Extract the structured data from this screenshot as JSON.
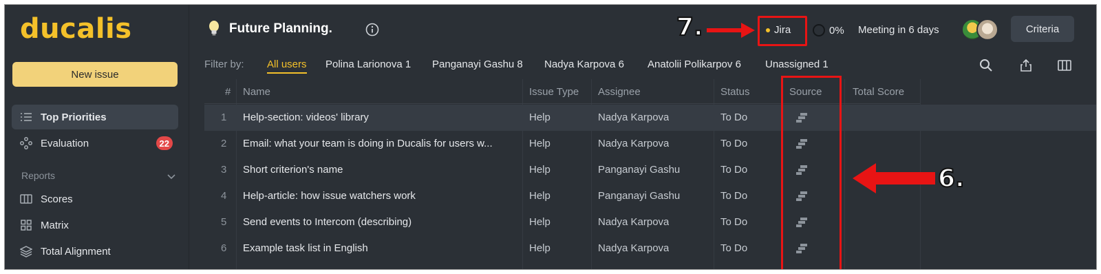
{
  "app": {
    "logo": "ducalis",
    "new_issue_label": "New issue"
  },
  "sidebar": {
    "items": [
      {
        "label": "Top Priorities",
        "icon": "list-icon",
        "active": true
      },
      {
        "label": "Evaluation",
        "icon": "nodes-icon",
        "badge": "22"
      }
    ],
    "reports_label": "Reports",
    "reports": [
      {
        "label": "Scores",
        "icon": "columns-icon"
      },
      {
        "label": "Matrix",
        "icon": "grid-icon"
      },
      {
        "label": "Total Alignment",
        "icon": "layers-icon"
      }
    ]
  },
  "header": {
    "title": "Future Planning.",
    "integration": "Jira",
    "progress": "0%",
    "meeting": "Meeting in 6 days",
    "criteria_label": "Criteria"
  },
  "annotations": {
    "seven": "7.",
    "six": "6."
  },
  "filter": {
    "label": "Filter by:",
    "items": [
      "All users",
      "Polina Larionova 1",
      "Panganayi Gashu 8",
      "Nadya Karpova 6",
      "Anatolii Polikarpov 6",
      "Unassigned 1"
    ]
  },
  "table": {
    "headers": [
      "#",
      "Name",
      "Issue Type",
      "Assignee",
      "Status",
      "Source",
      "Total Score"
    ],
    "rows": [
      {
        "num": "1",
        "name": "Help-section: videos' library",
        "type": "Help",
        "assignee": "Nadya Karpova",
        "status": "To Do"
      },
      {
        "num": "2",
        "name": "Email: what your team is doing in Ducalis for users w...",
        "type": "Help",
        "assignee": "Nadya Karpova",
        "status": "To Do"
      },
      {
        "num": "3",
        "name": "Short criterion's name",
        "type": "Help",
        "assignee": "Panganayi Gashu",
        "status": "To Do"
      },
      {
        "num": "4",
        "name": "Help-article: how issue watchers work",
        "type": "Help",
        "assignee": "Panganayi Gashu",
        "status": "To Do"
      },
      {
        "num": "5",
        "name": "Send events to Intercom (describing)",
        "type": "Help",
        "assignee": "Nadya Karpova",
        "status": "To Do"
      },
      {
        "num": "6",
        "name": "Example task list in English",
        "type": "Help",
        "assignee": "Nadya Karpova",
        "status": "To Do"
      }
    ]
  },
  "colors": {
    "accent": "#f4c12a",
    "background": "#2b3036",
    "annotation_red": "#e81414"
  }
}
